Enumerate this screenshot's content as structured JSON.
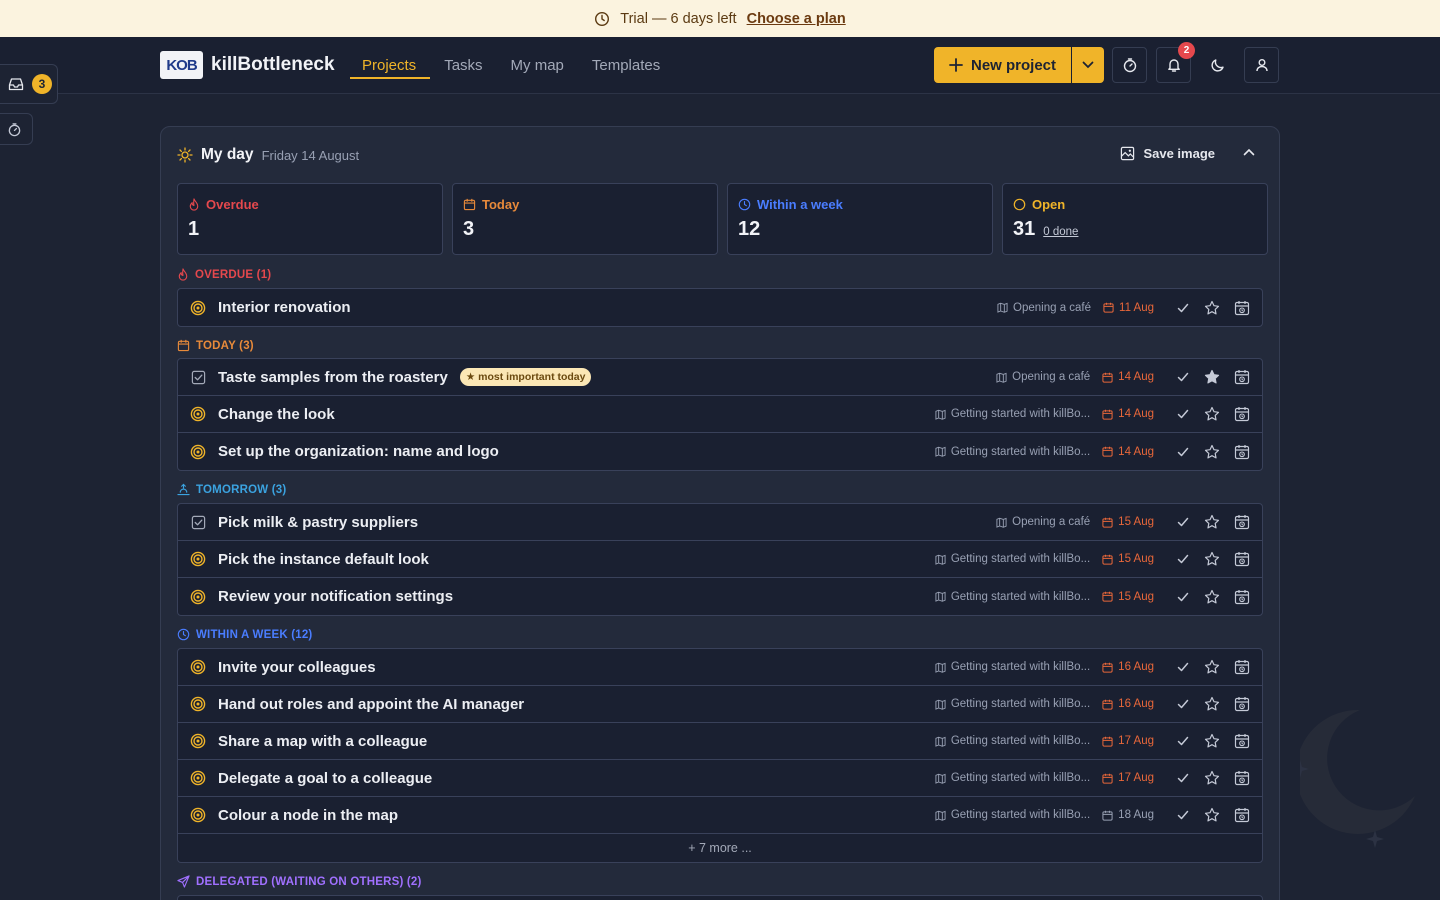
{
  "trial": {
    "text": "Trial — 6 days left",
    "link": "Choose a plan"
  },
  "header": {
    "brand": "killBottleneck",
    "logo_text": "KOB",
    "nav": [
      {
        "label": "Projects",
        "active": true
      },
      {
        "label": "Tasks",
        "active": false
      },
      {
        "label": "My map",
        "active": false
      },
      {
        "label": "Templates",
        "active": false
      }
    ],
    "new_project": "New project",
    "notifications_count": "2"
  },
  "sidebar": {
    "inbox_count": "3"
  },
  "myday": {
    "title": "My day",
    "date": "Friday 14 August",
    "save_image": "Save image",
    "stats": {
      "overdue": {
        "label": "Overdue",
        "value": "1"
      },
      "today": {
        "label": "Today",
        "value": "3"
      },
      "week": {
        "label": "Within a week",
        "value": "12"
      },
      "open": {
        "label": "Open",
        "value": "31",
        "sub": "0 done"
      }
    },
    "sections": {
      "overdue": {
        "header": "OVERDUE (1)",
        "rows": [
          {
            "title": "Interior renovation",
            "project": "Opening a café",
            "date": "11 Aug"
          }
        ]
      },
      "today": {
        "header": "TODAY (3)",
        "rows": [
          {
            "title": "Taste samples from the roastery",
            "pill": "★ most important today",
            "project": "Opening a café",
            "date": "14 Aug"
          },
          {
            "title": "Change the look",
            "project": "Getting started with killBo...",
            "date": "14 Aug"
          },
          {
            "title": "Set up the organization: name and logo",
            "project": "Getting started with killBo...",
            "date": "14 Aug"
          }
        ]
      },
      "tomorrow": {
        "header": "TOMORROW (3)",
        "rows": [
          {
            "title": "Pick milk & pastry suppliers",
            "project": "Opening a café",
            "date": "15 Aug"
          },
          {
            "title": "Pick the instance default look",
            "project": "Getting started with killBo...",
            "date": "15 Aug"
          },
          {
            "title": "Review your notification settings",
            "project": "Getting started with killBo...",
            "date": "15 Aug"
          }
        ]
      },
      "week": {
        "header": "WITHIN A WEEK (12)",
        "rows": [
          {
            "title": "Invite your colleagues",
            "project": "Getting started with killBo...",
            "date": "16 Aug"
          },
          {
            "title": "Hand out roles and appoint the AI manager",
            "project": "Getting started with killBo...",
            "date": "16 Aug"
          },
          {
            "title": "Share a map with a colleague",
            "project": "Getting started with killBo...",
            "date": "17 Aug"
          },
          {
            "title": "Delegate a goal to a colleague",
            "project": "Getting started with killBo...",
            "date": "17 Aug"
          },
          {
            "title": "Colour a node in the map",
            "project": "Getting started with killBo...",
            "date": "18 Aug"
          }
        ],
        "more": "+ 7 more ..."
      },
      "delegated": {
        "header": "DELEGATED (WAITING ON OTHERS) (2)"
      }
    }
  },
  "colors": {
    "accent": "#f0b429",
    "overdue": "#e5484d",
    "today": "#e88a3a",
    "tomorrow": "#3ba3e0",
    "week": "#4a7dff",
    "delegated": "#a070ff",
    "date": "#e8673a"
  }
}
